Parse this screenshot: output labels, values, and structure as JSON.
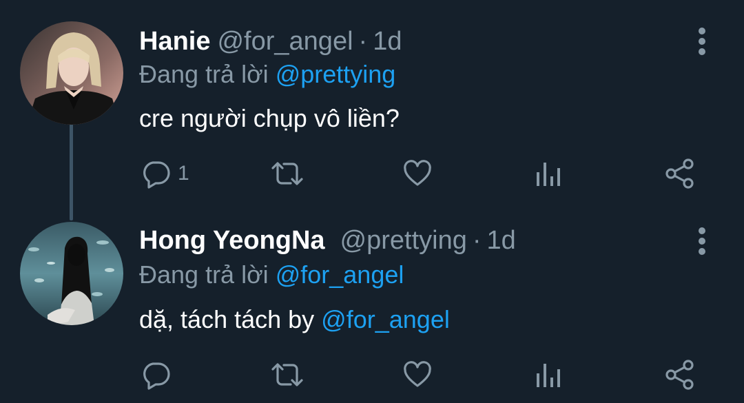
{
  "tweets": [
    {
      "name": "Hanie",
      "handle": "@for_angel",
      "separator": "·",
      "time": "1d",
      "replying_prefix": "Đang trả lời",
      "replying_to": "@prettying",
      "text": "cre người chụp vô liền?",
      "reply_count": "1"
    },
    {
      "name": "Hong YeongNa",
      "handle": "@prettying",
      "separator": "·",
      "time": "1d",
      "replying_prefix": "Đang trả lời",
      "replying_to": "@for_angel",
      "text": "dặ, tách tách by ",
      "text_mention": "@for_angel",
      "reply_count": ""
    }
  ],
  "colors": {
    "background": "#15202b",
    "primary_text": "#ffffff",
    "secondary_text": "#8899a6",
    "accent": "#1da1f2"
  },
  "icons": [
    "reply-icon",
    "retweet-icon",
    "like-icon",
    "analytics-icon",
    "share-icon",
    "more-options-icon"
  ]
}
